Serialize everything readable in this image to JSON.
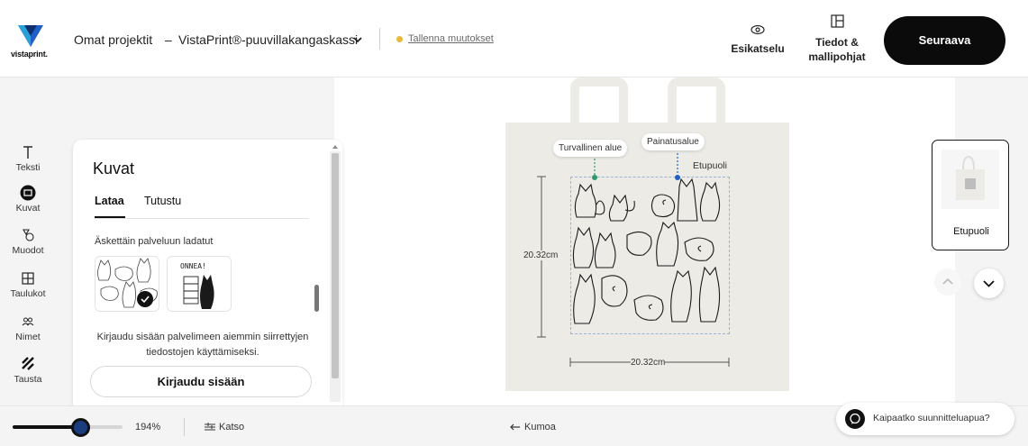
{
  "header": {
    "logo_text": "vistaprint.",
    "projects_label": "Omat projektit",
    "separator": "–",
    "product_name": "VistaPrint®-puuvillakangaskassi",
    "save_status": "Tallenna muutokset",
    "preview_label": "Esikatselu",
    "details_label_line1": "Tiedot &",
    "details_label_line2": "mallipohjat",
    "next_label": "Seuraava"
  },
  "rail": {
    "items": [
      {
        "label": "Teksti",
        "icon": "text-icon"
      },
      {
        "label": "Kuvat",
        "icon": "image-icon"
      },
      {
        "label": "Muodot",
        "icon": "shapes-icon"
      },
      {
        "label": "Taulukot",
        "icon": "table-icon"
      },
      {
        "label": "Nimet",
        "icon": "people-icon"
      },
      {
        "label": "Tausta",
        "icon": "background-icon"
      }
    ]
  },
  "panel": {
    "title": "Kuvat",
    "tabs": [
      {
        "label": "Lataa",
        "active": true
      },
      {
        "label": "Tutustu",
        "active": false
      }
    ],
    "recent_label": "Äskettäin palveluun ladatut",
    "thumb2_text": "ONNEA!",
    "login_text": "Kirjaudu sisään palvelimeen aiemmin siirrettyjen tiedostojen käyttämiseksi.",
    "login_button": "Kirjaudu sisään"
  },
  "canvas": {
    "safe_area_label": "Turvallinen alue",
    "print_area_label": "Painatusalue",
    "side_label": "Etupuoli",
    "height_dimension": "20.32cm",
    "width_dimension": "20.32cm"
  },
  "sides": {
    "current_side": "Etupuoli"
  },
  "footer": {
    "zoom_value": "194%",
    "zoom_level": 0.62,
    "view_label": "Katso",
    "undo_label": "Kumoa",
    "help_label": "Kaipaatko suunnitteluapua?"
  },
  "colors": {
    "accent_blue": "#1f5fc7",
    "safe_green": "#2c9a6a",
    "unsaved_dot": "#e8b93c",
    "primary_button": "#0b0b0b"
  }
}
